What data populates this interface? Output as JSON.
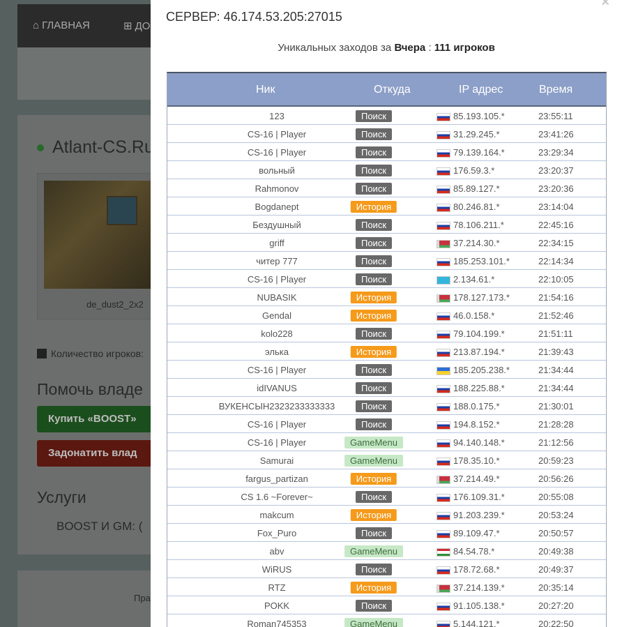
{
  "background": {
    "nav": {
      "home": "ГЛАВНАЯ",
      "add": "ДО"
    },
    "server_title": "Atlant-CS.Ru",
    "map_name": "de_dust2_2x2",
    "players_label": "Количество игроков:",
    "help_heading": "Помочь владе",
    "boost_button": "Купить «BOOST»",
    "donate_button": "Задонатить влад",
    "services_heading": "Услуги",
    "boost_gm_label": "BOOST И GM:   (",
    "footer_text": "Пра"
  },
  "modal": {
    "close": "×",
    "server_label": "СЕРВЕР: 46.174.53.205:27015",
    "unique_prefix": "Уникальных заходов за",
    "unique_period": "Вчера",
    "unique_sep": ":",
    "unique_count": "111 игроков",
    "columns": {
      "nick": "Ник",
      "source": "Откуда",
      "ip": "IP адрес",
      "time": "Время"
    },
    "rows": [
      {
        "nick": "123",
        "source": "Поиск",
        "type": "poisk",
        "flag": "ru",
        "ip": "85.193.105.*",
        "time": "23:55:11"
      },
      {
        "nick": "CS-16 | Player",
        "source": "Поиск",
        "type": "poisk",
        "flag": "ru",
        "ip": "31.29.245.*",
        "time": "23:41:26"
      },
      {
        "nick": "CS-16 | Player",
        "source": "Поиск",
        "type": "poisk",
        "flag": "ru",
        "ip": "79.139.164.*",
        "time": "23:29:34"
      },
      {
        "nick": "вольный",
        "source": "Поиск",
        "type": "poisk",
        "flag": "ru",
        "ip": "176.59.3.*",
        "time": "23:20:37"
      },
      {
        "nick": "Rahmonov",
        "source": "Поиск",
        "type": "poisk",
        "flag": "ru",
        "ip": "85.89.127.*",
        "time": "23:20:36"
      },
      {
        "nick": "Bogdanept",
        "source": "История",
        "type": "history",
        "flag": "ru",
        "ip": "80.246.81.*",
        "time": "23:14:04"
      },
      {
        "nick": "Бездушный",
        "source": "Поиск",
        "type": "poisk",
        "flag": "ru",
        "ip": "78.106.211.*",
        "time": "22:45:16"
      },
      {
        "nick": "griff",
        "source": "Поиск",
        "type": "poisk",
        "flag": "by",
        "ip": "37.214.30.*",
        "time": "22:34:15"
      },
      {
        "nick": "читер 777",
        "source": "Поиск",
        "type": "poisk",
        "flag": "ru",
        "ip": "185.253.101.*",
        "time": "22:14:34"
      },
      {
        "nick": "CS-16 | Player",
        "source": "Поиск",
        "type": "poisk",
        "flag": "kz",
        "ip": "2.134.61.*",
        "time": "22:10:05"
      },
      {
        "nick": "NUBASIK",
        "source": "История",
        "type": "history",
        "flag": "by",
        "ip": "178.127.173.*",
        "time": "21:54:16"
      },
      {
        "nick": "Gendal",
        "source": "История",
        "type": "history",
        "flag": "ru",
        "ip": "46.0.158.*",
        "time": "21:52:46"
      },
      {
        "nick": "kolo228",
        "source": "Поиск",
        "type": "poisk",
        "flag": "ru",
        "ip": "79.104.199.*",
        "time": "21:51:11"
      },
      {
        "nick": "элька",
        "source": "История",
        "type": "history",
        "flag": "ru",
        "ip": "213.87.194.*",
        "time": "21:39:43"
      },
      {
        "nick": "CS-16 | Player",
        "source": "Поиск",
        "type": "poisk",
        "flag": "ua",
        "ip": "185.205.238.*",
        "time": "21:34:44"
      },
      {
        "nick": "idIVANUS",
        "source": "Поиск",
        "type": "poisk",
        "flag": "ru",
        "ip": "188.225.88.*",
        "time": "21:34:44"
      },
      {
        "nick": "ВУКЕНСЫН2323233333333",
        "source": "Поиск",
        "type": "poisk",
        "flag": "ru",
        "ip": "188.0.175.*",
        "time": "21:30:01"
      },
      {
        "nick": "CS-16 | Player",
        "source": "Поиск",
        "type": "poisk",
        "flag": "ru",
        "ip": "194.8.152.*",
        "time": "21:28:28"
      },
      {
        "nick": "CS-16 | Player",
        "source": "GameMenu",
        "type": "gamemenu",
        "flag": "ru",
        "ip": "94.140.148.*",
        "time": "21:12:56"
      },
      {
        "nick": "Samurai",
        "source": "GameMenu",
        "type": "gamemenu",
        "flag": "ru",
        "ip": "178.35.10.*",
        "time": "20:59:23"
      },
      {
        "nick": "fargus_partizan",
        "source": "История",
        "type": "history",
        "flag": "by",
        "ip": "37.214.49.*",
        "time": "20:56:26"
      },
      {
        "nick": "CS 1.6 ~Forever~",
        "source": "Поиск",
        "type": "poisk",
        "flag": "ru",
        "ip": "176.109.31.*",
        "time": "20:55:08"
      },
      {
        "nick": "makcum",
        "source": "История",
        "type": "history",
        "flag": "ru",
        "ip": "91.203.239.*",
        "time": "20:53:24"
      },
      {
        "nick": "Fox_Puro",
        "source": "Поиск",
        "type": "poisk",
        "flag": "ru",
        "ip": "89.109.47.*",
        "time": "20:50:57"
      },
      {
        "nick": "abv",
        "source": "GameMenu",
        "type": "gamemenu",
        "flag": "tj",
        "ip": "84.54.78.*",
        "time": "20:49:38"
      },
      {
        "nick": "WiRUS",
        "source": "Поиск",
        "type": "poisk",
        "flag": "ru",
        "ip": "178.72.68.*",
        "time": "20:49:37"
      },
      {
        "nick": "RTZ",
        "source": "История",
        "type": "history",
        "flag": "by",
        "ip": "37.214.139.*",
        "time": "20:35:14"
      },
      {
        "nick": "POKK",
        "source": "Поиск",
        "type": "poisk",
        "flag": "ru",
        "ip": "91.105.138.*",
        "time": "20:27:20"
      },
      {
        "nick": "Roman745353",
        "source": "GameMenu",
        "type": "gamemenu",
        "flag": "ru",
        "ip": "5.144.121.*",
        "time": "20:22:50"
      }
    ]
  }
}
